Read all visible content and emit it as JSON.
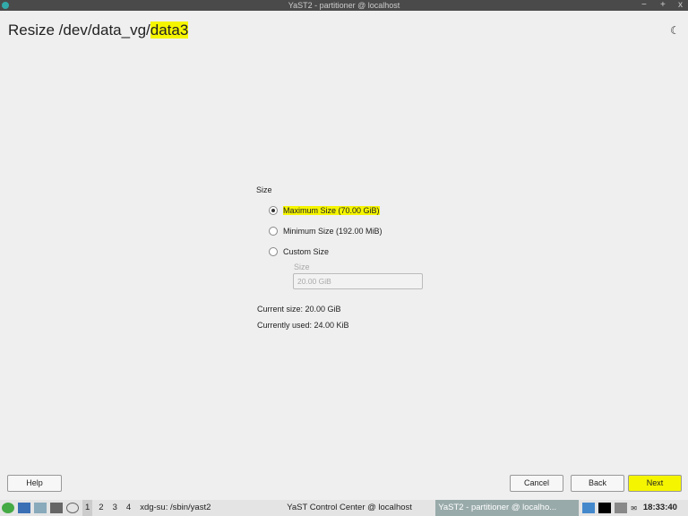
{
  "window": {
    "title": "YaST2 - partitioner @ localhost",
    "controls": [
      "−",
      "+",
      "x"
    ]
  },
  "heading": {
    "prefix": "Resize /dev/data_vg/",
    "device": "data3"
  },
  "size_group": {
    "label": "Size",
    "options": [
      {
        "label": "Maximum Size (70.00 GiB)",
        "selected": true
      },
      {
        "label": "Minimum Size (192.00 MiB)",
        "selected": false
      },
      {
        "label": "Custom Size",
        "selected": false
      }
    ],
    "custom_label": "Size",
    "custom_value": "20.00 GiB"
  },
  "info": {
    "current_size": "Current size: 20.00 GiB",
    "currently_used": "Currently used: 24.00 KiB"
  },
  "buttons": {
    "help": "Help",
    "cancel": "Cancel",
    "back": "Back",
    "next": "Next"
  },
  "taskbar": {
    "workspaces": [
      "1",
      "2",
      "3",
      "4"
    ],
    "tasks": [
      "xdg-su: /sbin/yast2",
      "YaST Control Center @ localhost",
      "YaST2 - partitioner @ localho..."
    ],
    "clock": "18:33:40"
  }
}
